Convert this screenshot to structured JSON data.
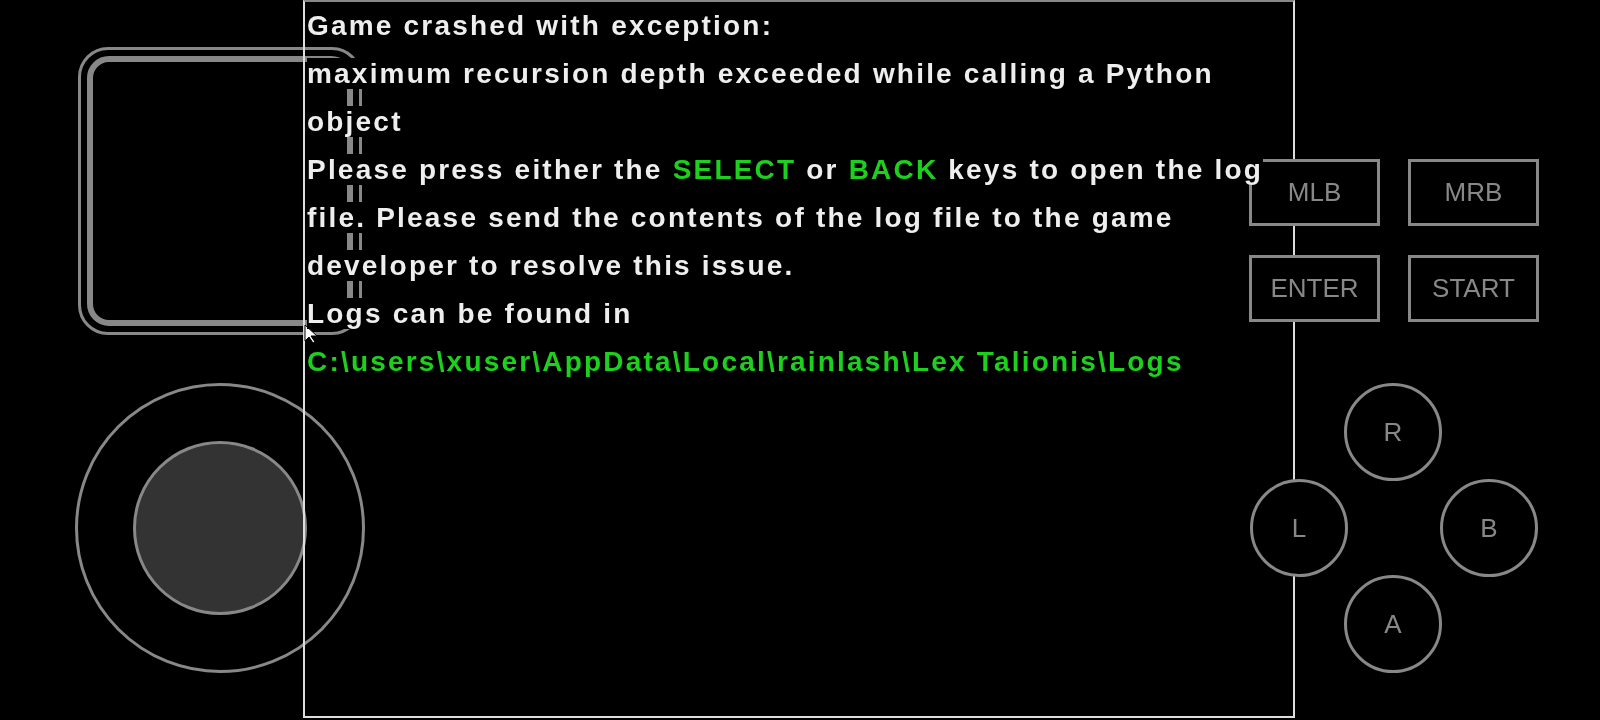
{
  "crash_screen": {
    "paragraphs": [
      {
        "segments": [
          {
            "text": "Game crashed with exception:",
            "highlight": false
          }
        ]
      },
      {
        "segments": [
          {
            "text": "maximum recursion depth exceeded while calling a Python object",
            "highlight": false
          }
        ]
      },
      {
        "segments": [
          {
            "text": "Please press either the ",
            "highlight": false
          },
          {
            "text": "SELECT",
            "highlight": true
          },
          {
            "text": " or ",
            "highlight": false
          },
          {
            "text": "BACK",
            "highlight": true
          },
          {
            "text": " keys to open the log file. Please send the contents of the log file to the game developer to resolve this issue.",
            "highlight": false
          }
        ]
      },
      {
        "segments": [
          {
            "text": "Logs can be found in",
            "highlight": false
          }
        ]
      },
      {
        "segments": [
          {
            "text": "C:\\users\\xuser\\AppData\\Local\\rainlash\\Lex Talionis\\Logs",
            "highlight": true
          }
        ]
      }
    ]
  },
  "buttons": [
    {
      "label": "MLB",
      "kind": "rect"
    },
    {
      "label": "MRB",
      "kind": "rect"
    },
    {
      "label": "ENTER",
      "kind": "rect"
    },
    {
      "label": "START",
      "kind": "rect"
    },
    {
      "label": "R",
      "kind": "round"
    },
    {
      "label": "L",
      "kind": "round"
    },
    {
      "label": "B",
      "kind": "round"
    },
    {
      "label": "A",
      "kind": "round"
    }
  ]
}
